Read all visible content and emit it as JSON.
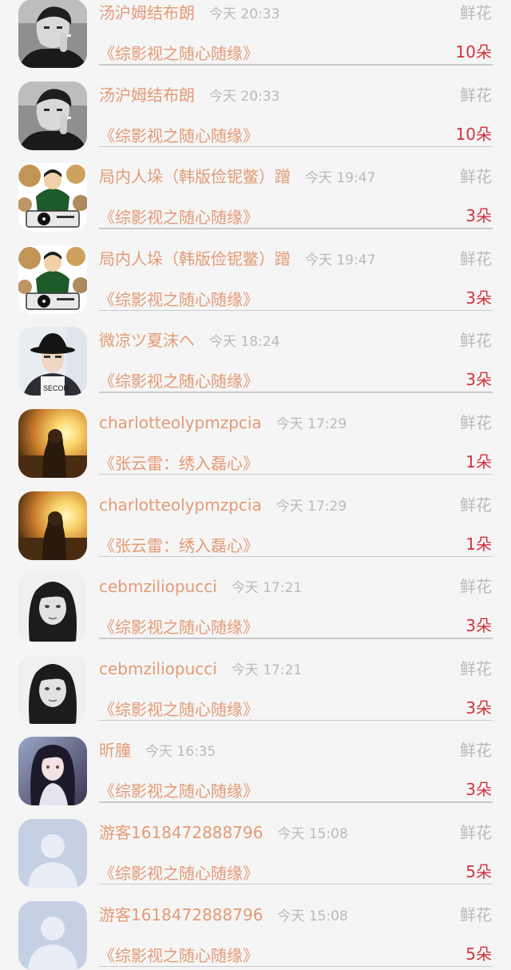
{
  "records": [
    {
      "user": "汤沪姆结布朗",
      "time": "今天 20:33",
      "gift": "鲜花",
      "book": "《综影视之随心随缘》",
      "amount": "10朵",
      "avatar": "man-smoking-avatar"
    },
    {
      "user": "汤沪姆结布朗",
      "time": "今天 20:33",
      "gift": "鲜花",
      "book": "《综影视之随心随缘》",
      "amount": "10朵",
      "avatar": "man-smoking-avatar"
    },
    {
      "user": "局内人垛（韩版俭铌鳖）蹭",
      "time": "今天 19:47",
      "gift": "鲜花",
      "book": "《综影视之随心随缘》",
      "amount": "3朵",
      "avatar": "dj-cartoon-avatar"
    },
    {
      "user": "局内人垛（韩版俭铌鳖）蹭",
      "time": "今天 19:47",
      "gift": "鲜花",
      "book": "《综影视之随心随缘》",
      "amount": "3朵",
      "avatar": "dj-cartoon-avatar"
    },
    {
      "user": "微凉ツ夏沫へ",
      "time": "今天 18:24",
      "gift": "鲜花",
      "book": "《综影视之随心随缘》",
      "amount": "3朵",
      "avatar": "hat-boy-avatar"
    },
    {
      "user": "charlotteolypmzpcia",
      "time": "今天 17:29",
      "gift": "鲜花",
      "book": "《张云雷：绣入磊心》",
      "amount": "1朵",
      "avatar": "sunset-girl-avatar"
    },
    {
      "user": "charlotteolypmzpcia",
      "time": "今天 17:29",
      "gift": "鲜花",
      "book": "《张云雷：绣入磊心》",
      "amount": "1朵",
      "avatar": "sunset-girl-avatar"
    },
    {
      "user": "cebmziliopucci",
      "time": "今天 17:21",
      "gift": "鲜花",
      "book": "《综影视之随心随缘》",
      "amount": "3朵",
      "avatar": "bw-woman-avatar"
    },
    {
      "user": "cebmziliopucci",
      "time": "今天 17:21",
      "gift": "鲜花",
      "book": "《综影视之随心随缘》",
      "amount": "3朵",
      "avatar": "bw-woman-avatar"
    },
    {
      "user": "昕膧",
      "time": "今天 16:35",
      "gift": "鲜花",
      "book": "《综影视之随心随缘》",
      "amount": "3朵",
      "avatar": "anime-girl-avatar"
    },
    {
      "user": "游客1618472888796",
      "time": "今天 15:08",
      "gift": "鲜花",
      "book": "《综影视之随心随缘》",
      "amount": "5朵",
      "avatar": "default-user-avatar"
    },
    {
      "user": "游客1618472888796",
      "time": "今天 15:08",
      "gift": "鲜花",
      "book": "《综影视之随心随缘》",
      "amount": "5朵",
      "avatar": "default-user-avatar"
    }
  ]
}
